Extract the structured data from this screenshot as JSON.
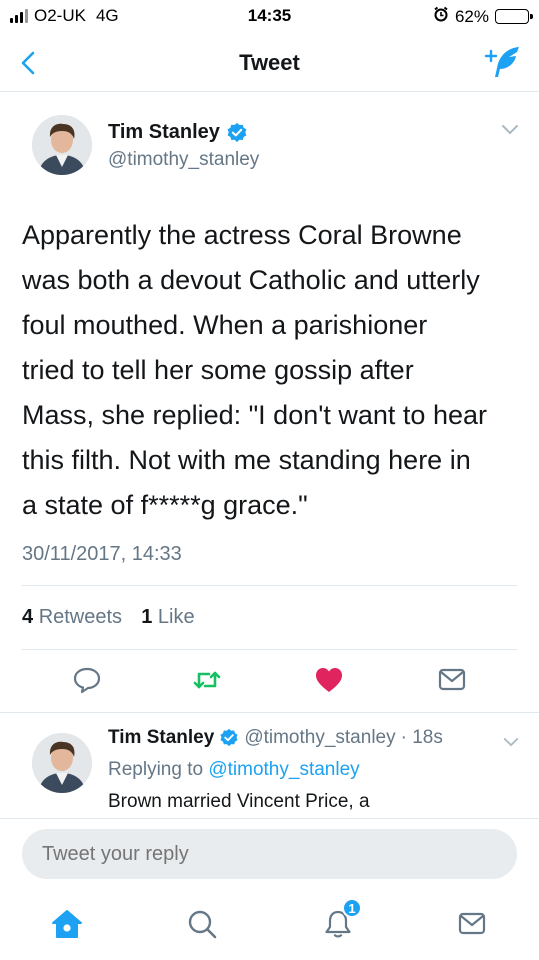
{
  "status_bar": {
    "carrier": "O2-UK",
    "network": "4G",
    "time": "14:35",
    "battery": "62%",
    "battery_level": 0.62
  },
  "nav": {
    "title": "Tweet"
  },
  "tweet": {
    "author_name": "Tim Stanley",
    "author_handle": "@timothy_stanley",
    "lines": [
      "Apparently the actress Coral Browne",
      "was both a devout Catholic and utterly",
      "foul mouthed. When a parishioner",
      "tried to tell her some gossip after",
      "Mass, she replied: \"I don't want to hear",
      "this filth. Not with me standing here in",
      "a state of f*****g grace.\""
    ],
    "timestamp": "30/11/2017, 14:33",
    "retweet_count": "4",
    "retweet_label": "Retweets",
    "like_count": "1",
    "like_label": "Like"
  },
  "reply": {
    "author_name": "Tim Stanley",
    "author_handle": "@timothy_stanley",
    "time": "· 18s",
    "replying_label": "Replying to",
    "replying_handle": "@timothy_stanley",
    "text": "Brown married Vincent Price, a"
  },
  "compose": {
    "placeholder": "Tweet your reply"
  },
  "tabs": {
    "notifications_badge": "1"
  },
  "colors": {
    "accent": "#1da1f2",
    "retweet": "#17bf63",
    "like": "#e0245e",
    "muted": "#657786"
  }
}
